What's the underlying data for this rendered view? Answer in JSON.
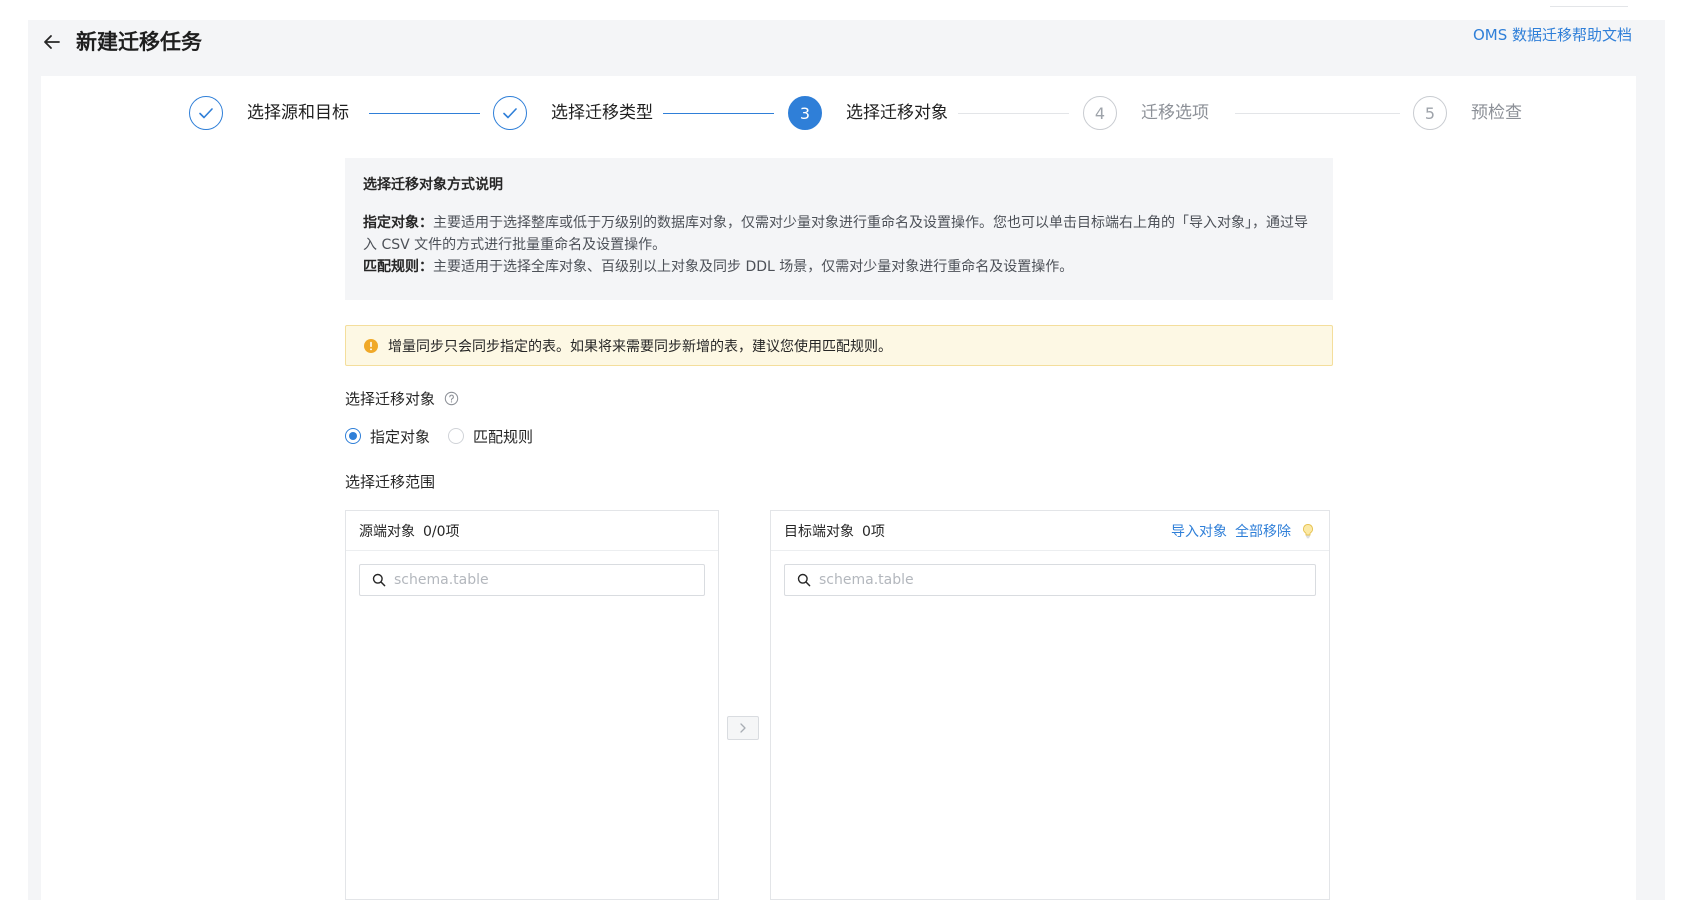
{
  "header": {
    "title": "新建迁移任务",
    "help_link": "OMS 数据迁移帮助文档"
  },
  "steps": [
    {
      "index": "1",
      "label": "选择源和目标",
      "state": "done"
    },
    {
      "index": "2",
      "label": "选择迁移类型",
      "state": "done"
    },
    {
      "index": "3",
      "label": "选择迁移对象",
      "state": "active"
    },
    {
      "index": "4",
      "label": "迁移选项",
      "state": "pending"
    },
    {
      "index": "5",
      "label": "预检查",
      "state": "pending"
    }
  ],
  "info": {
    "title": "选择迁移对象方式说明",
    "specify_label": "指定对象：",
    "specify_text": "主要适用于选择整库或低于万级别的数据库对象，仅需对少量对象进行重命名及设置操作。您也可以单击目标端右上角的「导入对象」，通过导入 CSV 文件的方式进行批量重命名及设置操作。",
    "match_label": "匹配规则：",
    "match_text": "主要适用于选择全库对象、百级别以上对象及同步 DDL 场景，仅需对少量对象进行重命名及设置操作。"
  },
  "warning": {
    "text": "增量同步只会同步指定的表。如果将来需要同步新增的表，建议您使用匹配规则。"
  },
  "object_select": {
    "label": "选择迁移对象",
    "options": [
      {
        "label": "指定对象",
        "checked": true
      },
      {
        "label": "匹配规则",
        "checked": false
      }
    ]
  },
  "scope": {
    "label": "选择迁移范围",
    "source": {
      "title": "源端对象",
      "count": "0/0项",
      "search_placeholder": "schema.table"
    },
    "target": {
      "title": "目标端对象",
      "count": "0项",
      "import_label": "导入对象",
      "remove_all_label": "全部移除",
      "search_placeholder": "schema.table"
    }
  },
  "colors": {
    "accent": "#2f7fd8",
    "warning_bg": "#fdf8e4",
    "warning_icon": "#f0a928"
  },
  "icons": {
    "back": "arrow-left-icon",
    "done_step": "check-icon",
    "warning": "exclamation-circle-icon",
    "help": "question-circle-icon",
    "search": "search-icon",
    "tip": "lightbulb-icon",
    "transfer": "chevron-right-icon"
  }
}
